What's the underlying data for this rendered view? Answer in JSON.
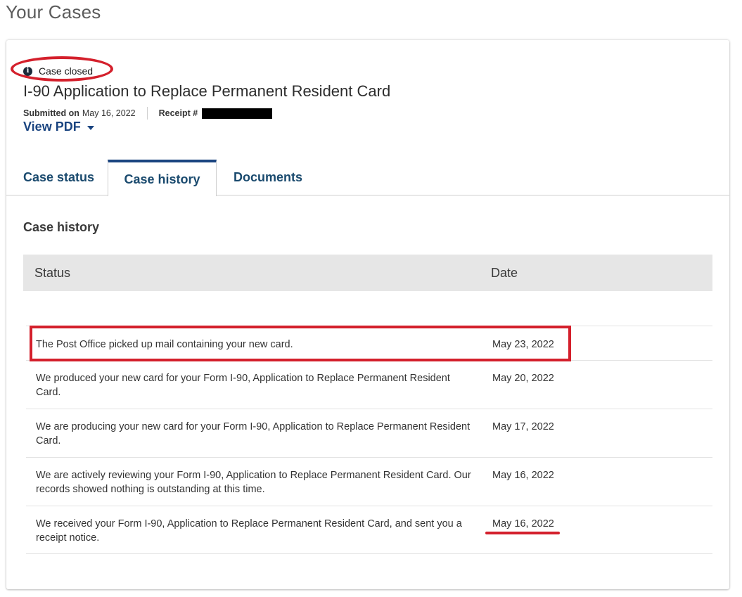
{
  "page": {
    "title": "Your Cases"
  },
  "case": {
    "status_label": "Case closed",
    "title": "I-90 Application to Replace Permanent Resident Card",
    "submitted_label": "Submitted on",
    "submitted_date": "May 16, 2022",
    "receipt_label": "Receipt #",
    "view_pdf_label": "View PDF"
  },
  "tabs": [
    {
      "label": "Case status",
      "active": false
    },
    {
      "label": "Case history",
      "active": true
    },
    {
      "label": "Documents",
      "active": false
    }
  ],
  "history": {
    "section_title": "Case history",
    "columns": {
      "status": "Status",
      "date": "Date"
    },
    "rows": [
      {
        "status": "The Post Office picked up mail containing your new card.",
        "date": "May 23, 2022"
      },
      {
        "status": "We produced your new card for your Form I-90, Application to Replace Permanent Resident Card.",
        "date": "May 20, 2022"
      },
      {
        "status": "We are producing your new card for your Form I-90, Application to Replace Permanent Resident Card.",
        "date": "May 17, 2022"
      },
      {
        "status": "We are actively reviewing your Form I-90, Application to Replace Permanent Resident Card. Our records showed nothing is outstanding at this time.",
        "date": "May 16, 2022"
      },
      {
        "status": "We received your Form I-90, Application to Replace Permanent Resident Card, and sent you a receipt notice.",
        "date": "May 16, 2022"
      }
    ]
  },
  "colors": {
    "accent": "#1a4480",
    "annotation": "#d4202c",
    "header_bg": "#e6e6e6"
  },
  "icons": {
    "status": "info-icon",
    "view_pdf": "caret-down-icon"
  }
}
